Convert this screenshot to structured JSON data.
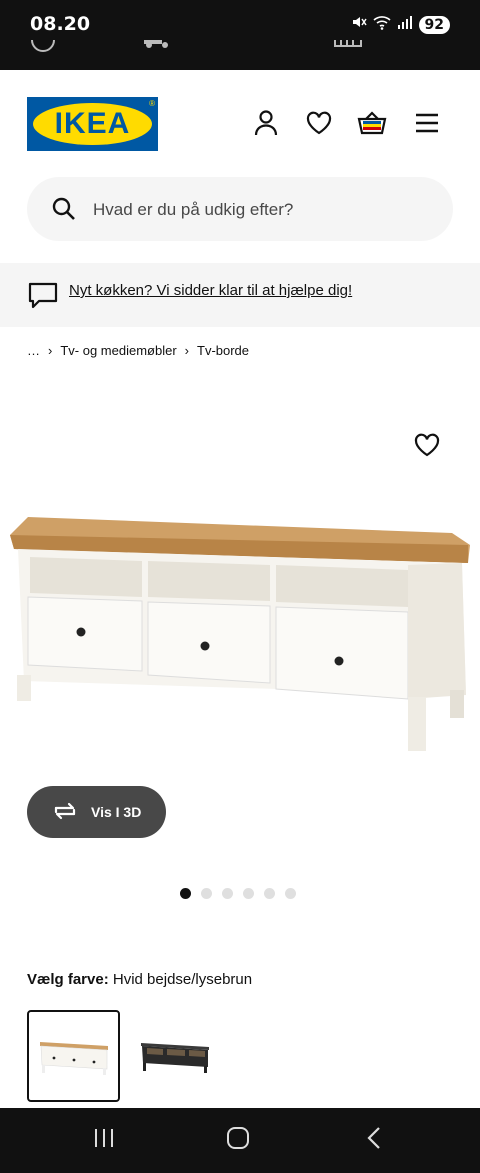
{
  "status_bar": {
    "time": "08.20",
    "battery": "92"
  },
  "header": {
    "logo_text": "IKEA"
  },
  "search": {
    "placeholder": "Hvad er du på udkig efter?"
  },
  "promo": {
    "text": "Nyt køkken? Vi sidder klar til at hjælpe dig!"
  },
  "breadcrumb": {
    "items": [
      "…",
      "Tv- og mediemøbler",
      "Tv-borde"
    ]
  },
  "product": {
    "view_3d_label": "Vis I 3D",
    "gallery_count": 6,
    "gallery_active_index": 0
  },
  "color": {
    "label": "Vælg farve:",
    "value": "Hvid bejdse/lysebrun"
  },
  "colors": {
    "accent_blue": "#0058a3",
    "accent_yellow": "#ffdb00"
  }
}
